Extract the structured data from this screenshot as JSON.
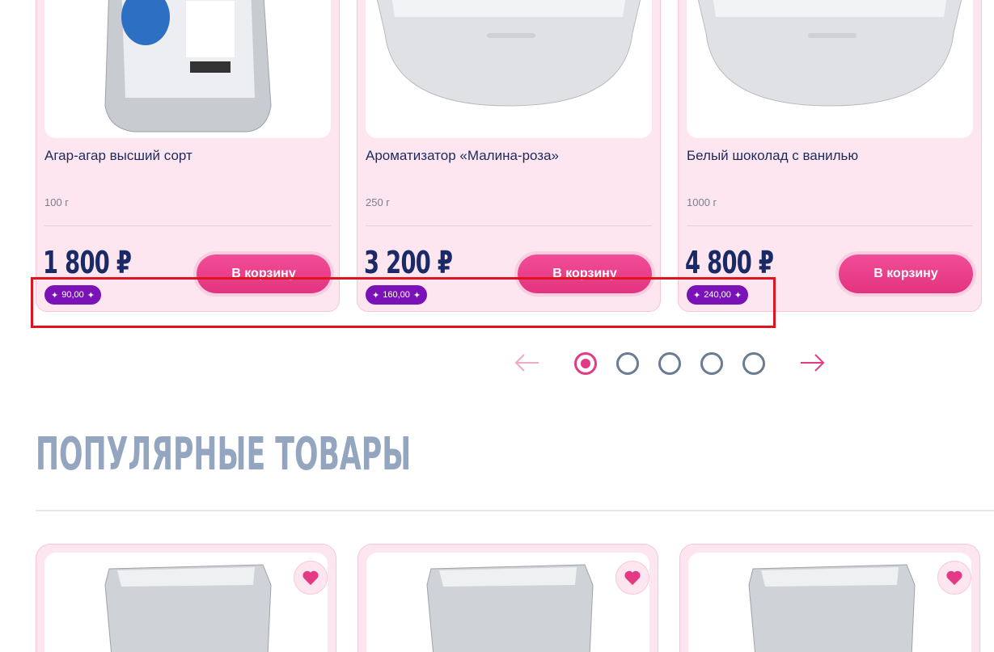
{
  "carousel": {
    "currency": "₽",
    "buy_label": "В корзину",
    "products": [
      {
        "name": "Агар-агар высший сорт",
        "weight": "100 г",
        "price": "1 800",
        "bonus": "90,00"
      },
      {
        "name": "Ароматизатор «Малина-роза»",
        "weight": "250 г",
        "price": "3 200",
        "bonus": "160,00"
      },
      {
        "name": "Белый шоколад с ванилью",
        "weight": "1000 г",
        "price": "4 800",
        "bonus": "240,00"
      }
    ],
    "pager": {
      "pages": 5,
      "active": 1
    }
  },
  "popular": {
    "title": "ПОПУЛЯРНЫЕ ТОВАРЫ"
  },
  "colors": {
    "accent": "#e43a86",
    "card_bg": "#fde6f0",
    "bonus": "#7a12b8",
    "price": "#1a2a66"
  }
}
